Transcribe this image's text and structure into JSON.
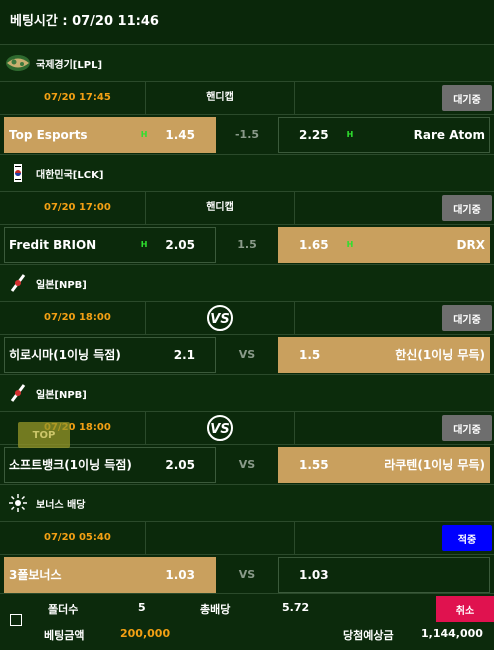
{
  "header": {
    "bet_time": "베팅시간 : 07/20 11:46"
  },
  "games": [
    {
      "league": "국제경기[LPL]",
      "league_icon": "globe-icon",
      "time": "07/20 17:45",
      "type": "핸디캡",
      "status": "대기중",
      "home": "Top Esports",
      "home_odd": "1.45",
      "home_flag": "H",
      "mid": "-1.5",
      "away": "Rare Atom",
      "away_odd": "2.25",
      "away_flag": "H",
      "selected": "home"
    },
    {
      "league": "대한민국[LCK]",
      "league_icon": "korea-flag-icon",
      "time": "07/20 17:00",
      "type": "핸디캡",
      "status": "대기중",
      "home": "Fredit BRION",
      "home_odd": "2.05",
      "home_flag": "H",
      "mid": "1.5",
      "away": "DRX",
      "away_odd": "1.65",
      "away_flag": "H",
      "selected": "away"
    },
    {
      "league": "일본[NPB]",
      "league_icon": "japan-flag-icon",
      "time": "07/20 18:00",
      "type_icon": "vs-icon",
      "status": "대기중",
      "home": "히로시마(1이닝 득점)",
      "home_odd": "2.1",
      "mid": "VS",
      "away": "한신(1이닝 무득)",
      "away_odd": "1.5",
      "selected": "away"
    },
    {
      "league": "일본[NPB]",
      "league_icon": "japan-flag-icon",
      "time": "07/20 18:00",
      "type_icon": "vs-icon",
      "status": "대기중",
      "home": "소프트뱅크(1이닝 득점)",
      "home_odd": "2.05",
      "mid": "VS",
      "away": "라쿠텐(1이닝 무득)",
      "away_odd": "1.55",
      "selected": "away"
    },
    {
      "league": "보너스 배당",
      "league_icon": "bonus-icon",
      "time": "07/20 05:40",
      "type": "",
      "status": "적중",
      "home": "3폴보너스",
      "home_odd": "1.03",
      "mid": "VS",
      "away": "",
      "away_odd": "1.03",
      "selected": "home"
    }
  ],
  "top_button": "TOP",
  "footer": {
    "folder_label": "폴더수",
    "folder_value": "5",
    "total_odds_label": "총배당",
    "total_odds_value": "5.72",
    "bet_amount_label": "베팅금액",
    "bet_amount_value": "200,000",
    "expected_label": "당첨예상금",
    "expected_value": "1,144,000",
    "cancel": "취소"
  },
  "colors": {
    "background": "#0c2a0c",
    "time": "#f3a014",
    "selected": "#c9a05e",
    "handicap_flag": "#2ee02e",
    "waiting": "#6e6e6e",
    "hit": "#0000ff",
    "cancel": "#e0124f"
  }
}
